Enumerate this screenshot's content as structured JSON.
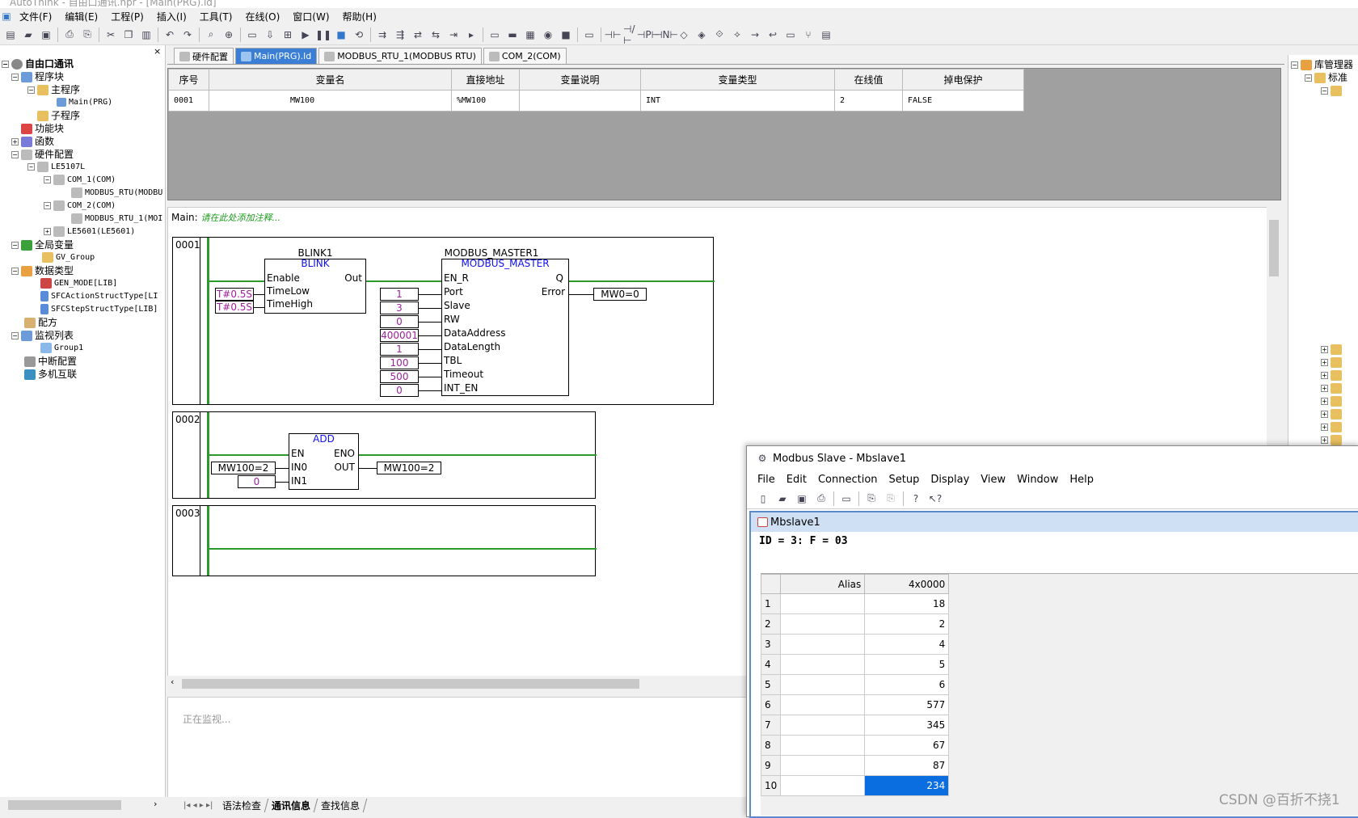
{
  "app": {
    "title": "AutoThink - 自由口通讯.hpr - [Main(PRG).ld]"
  },
  "menu": [
    "文件(F)",
    "编辑(E)",
    "工程(P)",
    "插入(I)",
    "工具(T)",
    "在线(O)",
    "窗口(W)",
    "帮助(H)"
  ],
  "tree": {
    "root": "自由口通讯",
    "program_block": "程序块",
    "main_program": "主程序",
    "main_prg": "Main(PRG)",
    "sub_program": "子程序",
    "function_block": "功能块",
    "function": "函数",
    "hw_config": "硬件配置",
    "plc": "LE5107L",
    "com1": "COM_1(COM)",
    "modbus1": "MODBUS_RTU(MODBU",
    "com2": "COM_2(COM)",
    "modbus2": "MODBUS_RTU_1(MOI",
    "le5601": "LE5601(LE5601)",
    "global_var": "全局变量",
    "gv_group": "GV_Group",
    "data_types": "数据类型",
    "gen_mode": "GEN_MODE[LIB]",
    "sfc_action": "SFCActionStructType[LI",
    "sfc_step": "SFCStepStructType[LIB]",
    "recipe": "配方",
    "watch_list": "监视列表",
    "group1": "Group1",
    "interrupt": "中断配置",
    "multi": "多机互联"
  },
  "tabs": [
    "硬件配置",
    "Main(PRG).ld",
    "MODBUS_RTU_1(MODBUS RTU)",
    "COM_2(COM)"
  ],
  "vargrid": {
    "headers": [
      "序号",
      "变量名",
      "直接地址",
      "变量说明",
      "变量类型",
      "在线值",
      "掉电保护"
    ],
    "row": [
      "0001",
      "MW100",
      "%MW100",
      "",
      "INT",
      "2",
      "FALSE"
    ]
  },
  "editor": {
    "label": "Main:",
    "comment": "请在此处添加注释...",
    "rungs": [
      "0001",
      "0002",
      "0003"
    ],
    "blink": {
      "name": "BLINK1",
      "type": "BLINK",
      "in": [
        "Enable",
        "TimeLow",
        "TimeHigh"
      ],
      "out": "Out",
      "vals": [
        "T#0.5S",
        "T#0.5S"
      ]
    },
    "mm": {
      "name": "MODBUS_MASTER1",
      "type": "MODBUS_MASTER",
      "in": [
        "EN_R",
        "Port",
        "Slave",
        "RW",
        "DataAddress",
        "DataLength",
        "TBL",
        "Timeout",
        "INT_EN"
      ],
      "outs": [
        "Q",
        "Error"
      ],
      "vals": [
        "1",
        "3",
        "0",
        "400001",
        "1",
        "100",
        "500",
        "0"
      ],
      "error_var": "MW0=0"
    },
    "add": {
      "type": "ADD",
      "in": [
        "EN",
        "IN0",
        "IN1"
      ],
      "outs": [
        "ENO",
        "OUT"
      ],
      "in0": "MW100=2",
      "in1": "0",
      "out_var": "MW100=2"
    }
  },
  "bottom": {
    "text": "正在监视...",
    "tabs": [
      "语法检查",
      "通讯信息",
      "查找信息"
    ]
  },
  "righttree": {
    "title": "库管理器",
    "item": "标准"
  },
  "mbslave": {
    "title": "Modbus Slave - Mbslave1",
    "menu": [
      "File",
      "Edit",
      "Connection",
      "Setup",
      "Display",
      "View",
      "Window",
      "Help"
    ],
    "child_title": "Mbslave1",
    "status": "ID = 3: F = 03",
    "col_alias": "Alias",
    "col_addr": "4x0000",
    "rows": [
      [
        "1",
        "18"
      ],
      [
        "2",
        "2"
      ],
      [
        "3",
        "4"
      ],
      [
        "4",
        "5"
      ],
      [
        "5",
        "6"
      ],
      [
        "6",
        "577"
      ],
      [
        "7",
        "345"
      ],
      [
        "8",
        "67"
      ],
      [
        "9",
        "87"
      ],
      [
        "10",
        "234"
      ]
    ]
  },
  "watermark": "CSDN @百折不挠1"
}
